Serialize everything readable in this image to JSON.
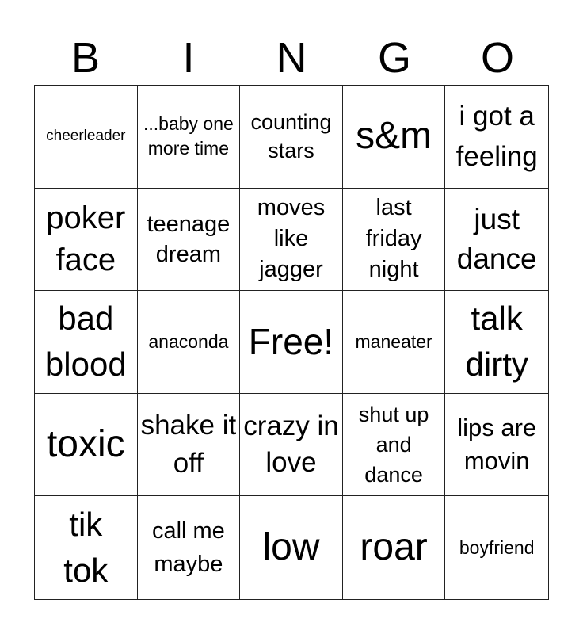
{
  "header": [
    "B",
    "I",
    "N",
    "G",
    "O"
  ],
  "cells": [
    "cheerleader",
    "...baby one more time",
    "counting stars",
    "s&m",
    "i got a feeling",
    "poker face",
    "teenage dream",
    "moves like jagger",
    "last friday night",
    "just dance",
    "bad blood",
    "anaconda",
    "Free!",
    "maneater",
    "talk dirty",
    "toxic",
    "shake it off",
    "crazy in love",
    "shut up and dance",
    "lips are movin",
    "tik tok",
    "call me maybe",
    "low",
    "roar",
    "boyfriend"
  ]
}
